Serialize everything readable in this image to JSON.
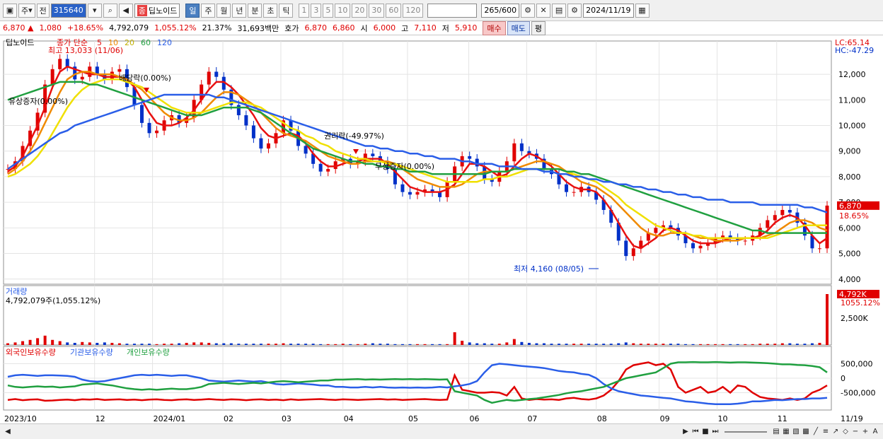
{
  "toolbar": {
    "period_type": "주",
    "previous_label": "전",
    "stock_code": "315640",
    "stock_name": "딥노이드",
    "stock_name_badge": "종",
    "tabs": [
      "일",
      "주",
      "월",
      "년",
      "분",
      "초",
      "틱"
    ],
    "active_tab": "일",
    "periods": [
      "1",
      "3",
      "5",
      "10",
      "20",
      "30",
      "60",
      "120"
    ],
    "count": "265/600",
    "date": "2024/11/19"
  },
  "quote": {
    "price": "6,870",
    "change": "1,080",
    "change_pct": "+18.65%",
    "volume": "4,792,079",
    "volume_ratio": "1,055.12%",
    "turnover": "21.37%",
    "amount": "31,693백만",
    "ask_label": "호가",
    "ask1": "6,870",
    "ask2": "6,860",
    "open_label": "시",
    "open": "6,000",
    "high_label": "고",
    "high": "7,110",
    "low_label": "저",
    "low": "5,910",
    "buy": "매수",
    "sell": "매도",
    "eval": "평"
  },
  "price_panel": {
    "name": "딥노이드",
    "legend_prefix": "종가 단순",
    "ma": [
      {
        "label": "5",
        "color": "#e81010"
      },
      {
        "label": "10",
        "color": "#f08a00"
      },
      {
        "label": "20",
        "color": "#f0e000"
      },
      {
        "label": "60",
        "color": "#20a040"
      },
      {
        "label": "120",
        "color": "#2a5ee8"
      }
    ],
    "lc": "LC:65.14",
    "hc": "HC:-47.29",
    "yticks": [
      "12,000",
      "11,000",
      "10,000",
      "9,000",
      "8,000",
      "7,000",
      "6,000",
      "5,000",
      "4,000"
    ],
    "last_price": "6,870",
    "last_pct": "18.65%",
    "annotations": {
      "high": "최고 13,033 (11/06)",
      "low": "최저 4,160 (08/05)",
      "dividend": "배당락(0.00%)",
      "rights": "권리락(-49.97%)",
      "bonus1": "무상증자(0.00%)",
      "bonus2": "유상증자(0.00%)"
    }
  },
  "volume_panel": {
    "title": "거래량",
    "value": "4,792,079주(1,055.12%)",
    "ytick": "2,500K",
    "last": "4,792K",
    "last_pct": "1055.12%"
  },
  "holding_panel": {
    "series": [
      {
        "name": "외국인보유수량",
        "color": "#e00000"
      },
      {
        "name": "기관보유수량",
        "color": "#2a5ee8"
      },
      {
        "name": "개인보유수량",
        "color": "#20a040"
      }
    ],
    "yticks": [
      "500,000",
      "0",
      "-500,000"
    ]
  },
  "xaxis": [
    "2023/10",
    "12",
    "2024/01",
    "02",
    "03",
    "04",
    "05",
    "06",
    "07",
    "08",
    "09",
    "10",
    "11",
    "11/19"
  ],
  "chart_data": {
    "type": "line",
    "title": "딥노이드",
    "x_labels": [
      "2023/10",
      "12",
      "2024/01",
      "02",
      "03",
      "04",
      "05",
      "06",
      "07",
      "08",
      "09",
      "10",
      "11",
      "11/19"
    ],
    "ylim": [
      3800,
      13300
    ],
    "close": [
      8300,
      8600,
      9200,
      9800,
      10500,
      11600,
      12200,
      12600,
      12300,
      11800,
      11900,
      12300,
      12000,
      11800,
      12100,
      12200,
      11500,
      10800,
      10100,
      9700,
      9800,
      10200,
      10400,
      10100,
      10300,
      11000,
      11600,
      12100,
      11900,
      11400,
      10800,
      10400,
      10000,
      9500,
      9100,
      9300,
      9700,
      10200,
      9800,
      9200,
      8900,
      8500,
      8200,
      8300,
      8600,
      8700,
      8500,
      8600,
      8900,
      8800,
      8600,
      8300,
      7700,
      7400,
      7300,
      7400,
      7500,
      7400,
      7200,
      7800,
      8400,
      8800,
      8700,
      8400,
      7900,
      7800,
      8200,
      8600,
      9300,
      9000,
      8900,
      8700,
      8300,
      8100,
      7700,
      7400,
      7400,
      7600,
      7400,
      7100,
      6700,
      6200,
      5500,
      4900,
      5200,
      5500,
      5800,
      6000,
      6100,
      6000,
      5700,
      5400,
      5200,
      5300,
      5400,
      5600,
      5700,
      5600,
      5500,
      5500,
      5700,
      6000,
      6300,
      6500,
      6700,
      6600,
      6200,
      5700,
      5200,
      5200,
      6870
    ],
    "series": [
      {
        "name": "5",
        "values": [
          8200,
          8400,
          8800,
          9400,
          10000,
          10700,
          11500,
          12100,
          12300,
          12200,
          12100,
          12000,
          12000,
          11900,
          11900,
          11900,
          11800,
          11500,
          11000,
          10500,
          10100,
          10000,
          10000,
          10100,
          10300,
          10600,
          11000,
          11400,
          11700,
          11700,
          11500,
          11200,
          10800,
          10400,
          9900,
          9600,
          9500,
          9600,
          9700,
          9600,
          9300,
          8900,
          8600,
          8400,
          8400,
          8500,
          8600,
          8600,
          8700,
          8700,
          8700,
          8500,
          8200,
          7900,
          7600,
          7500,
          7400,
          7400,
          7400,
          7500,
          7700,
          8100,
          8500,
          8500,
          8400,
          8200,
          8000,
          8100,
          8400,
          8700,
          8900,
          8800,
          8600,
          8400,
          8100,
          7800,
          7600,
          7500,
          7500,
          7400,
          7100,
          6700,
          6200,
          5700,
          5300,
          5200,
          5400,
          5600,
          5900,
          6000,
          5900,
          5700,
          5500,
          5400,
          5400,
          5400,
          5500,
          5600,
          5600,
          5600,
          5600,
          5700,
          5900,
          6200,
          6400,
          6500,
          6400,
          6100,
          5700,
          5400,
          5600
        ]
      },
      {
        "name": "10",
        "values": [
          8100,
          8300,
          8600,
          9000,
          9500,
          10100,
          10700,
          11300,
          11800,
          12000,
          12100,
          12100,
          12000,
          12000,
          12000,
          11900,
          11800,
          11600,
          11400,
          11100,
          10800,
          10500,
          10300,
          10200,
          10200,
          10300,
          10500,
          10800,
          11100,
          11300,
          11300,
          11200,
          11000,
          10800,
          10500,
          10200,
          9900,
          9700,
          9600,
          9500,
          9400,
          9200,
          9000,
          8800,
          8700,
          8600,
          8500,
          8500,
          8600,
          8600,
          8600,
          8600,
          8500,
          8300,
          8100,
          7900,
          7800,
          7700,
          7600,
          7600,
          7600,
          7700,
          7900,
          8100,
          8200,
          8200,
          8200,
          8200,
          8300,
          8400,
          8500,
          8600,
          8600,
          8500,
          8400,
          8200,
          8000,
          7800,
          7700,
          7600,
          7400,
          7200,
          6900,
          6600,
          6300,
          6000,
          5800,
          5700,
          5700,
          5800,
          5800,
          5800,
          5700,
          5600,
          5600,
          5500,
          5500,
          5500,
          5500,
          5600,
          5600,
          5600,
          5700,
          5800,
          6000,
          6200,
          6300,
          6300,
          6200,
          6000,
          5900
        ]
      },
      {
        "name": "20",
        "values": [
          8000,
          8100,
          8300,
          8500,
          8800,
          9200,
          9700,
          10200,
          10700,
          11100,
          11400,
          11600,
          11700,
          11800,
          11800,
          11800,
          11700,
          11600,
          11500,
          11300,
          11100,
          10900,
          10700,
          10600,
          10500,
          10500,
          10500,
          10600,
          10700,
          10800,
          10900,
          10900,
          10900,
          10800,
          10700,
          10500,
          10300,
          10100,
          9900,
          9800,
          9600,
          9500,
          9300,
          9200,
          9000,
          8900,
          8800,
          8700,
          8700,
          8600,
          8600,
          8500,
          8500,
          8400,
          8300,
          8200,
          8100,
          8000,
          7900,
          7800,
          7800,
          7800,
          7800,
          7800,
          7900,
          7900,
          8000,
          8000,
          8100,
          8200,
          8300,
          8300,
          8300,
          8300,
          8300,
          8200,
          8100,
          8000,
          7900,
          7800,
          7600,
          7400,
          7200,
          6900,
          6700,
          6500,
          6300,
          6100,
          6000,
          5900,
          5800,
          5800,
          5700,
          5700,
          5600,
          5600,
          5600,
          5600,
          5600,
          5600,
          5600,
          5600,
          5600,
          5700,
          5800,
          5900,
          6000,
          6100,
          6100,
          6100,
          6100
        ]
      },
      {
        "name": "60",
        "values": [
          11000,
          11100,
          11200,
          11300,
          11400,
          11500,
          11600,
          11700,
          11700,
          11700,
          11700,
          11600,
          11600,
          11500,
          11400,
          11300,
          11200,
          11100,
          11000,
          10900,
          10800,
          10700,
          10600,
          10500,
          10400,
          10400,
          10400,
          10500,
          10600,
          10700,
          10700,
          10700,
          10700,
          10600,
          10500,
          10300,
          10100,
          9900,
          9700,
          9500,
          9300,
          9100,
          9000,
          8900,
          8800,
          8700,
          8600,
          8600,
          8500,
          8500,
          8400,
          8400,
          8300,
          8300,
          8200,
          8200,
          8200,
          8100,
          8100,
          8100,
          8100,
          8100,
          8100,
          8100,
          8100,
          8200,
          8200,
          8200,
          8300,
          8300,
          8300,
          8300,
          8300,
          8300,
          8300,
          8200,
          8200,
          8100,
          8100,
          8000,
          7900,
          7800,
          7700,
          7600,
          7500,
          7400,
          7300,
          7200,
          7100,
          7000,
          6900,
          6800,
          6700,
          6600,
          6500,
          6400,
          6300,
          6200,
          6100,
          6000,
          5900,
          5900,
          5800,
          5800,
          5800,
          5800,
          5800,
          5800,
          5800,
          5800,
          5800
        ]
      },
      {
        "name": "120",
        "values": [
          8300,
          8500,
          8700,
          8900,
          9100,
          9300,
          9500,
          9700,
          9800,
          10000,
          10100,
          10200,
          10300,
          10400,
          10500,
          10600,
          10700,
          10800,
          10900,
          11000,
          11100,
          11200,
          11200,
          11200,
          11200,
          11200,
          11200,
          11200,
          11100,
          11100,
          11000,
          10900,
          10800,
          10700,
          10600,
          10500,
          10400,
          10300,
          10200,
          10100,
          10000,
          9900,
          9800,
          9700,
          9600,
          9500,
          9400,
          9300,
          9200,
          9200,
          9100,
          9100,
          9000,
          9000,
          8900,
          8900,
          8800,
          8800,
          8700,
          8700,
          8700,
          8600,
          8600,
          8500,
          8500,
          8500,
          8400,
          8400,
          8400,
          8300,
          8300,
          8300,
          8200,
          8200,
          8100,
          8100,
          8000,
          8000,
          7900,
          7900,
          7800,
          7800,
          7700,
          7700,
          7600,
          7600,
          7500,
          7500,
          7400,
          7400,
          7300,
          7300,
          7200,
          7200,
          7100,
          7100,
          7100,
          7000,
          7000,
          7000,
          7000,
          6900,
          6900,
          6900,
          6900,
          6900,
          6900,
          6800,
          6800,
          6700,
          6600
        ]
      }
    ],
    "volume": [
      4,
      6,
      9,
      12,
      16,
      22,
      12,
      9,
      6,
      5,
      7,
      6,
      5,
      6,
      5,
      4,
      3,
      3,
      3,
      3,
      2,
      3,
      3,
      4,
      5,
      6,
      6,
      5,
      4,
      4,
      4,
      3,
      3,
      3,
      3,
      3,
      3,
      4,
      3,
      3,
      3,
      3,
      2,
      2,
      2,
      3,
      2,
      2,
      3,
      4,
      3,
      3,
      2,
      2,
      2,
      2,
      2,
      2,
      2,
      2,
      30,
      10,
      6,
      4,
      4,
      3,
      3,
      6,
      14,
      7,
      5,
      4,
      4,
      3,
      3,
      3,
      3,
      3,
      3,
      3,
      3,
      3,
      4,
      6,
      4,
      3,
      3,
      3,
      3,
      3,
      3,
      2,
      2,
      2,
      2,
      2,
      2,
      2,
      2,
      2,
      2,
      3,
      3,
      3,
      4,
      4,
      3,
      3,
      4,
      5,
      120
    ],
    "holdings": {
      "foreign": [
        -0.75,
        -0.72,
        -0.76,
        -0.74,
        -0.73,
        -0.78,
        -0.77,
        -0.75,
        -0.74,
        -0.76,
        -0.73,
        -0.74,
        -0.72,
        -0.75,
        -0.74,
        -0.73,
        -0.75,
        -0.74,
        -0.76,
        -0.74,
        -0.73,
        -0.75,
        -0.76,
        -0.74,
        -0.73,
        -0.75,
        -0.74,
        -0.72,
        -0.74,
        -0.75,
        -0.73,
        -0.74,
        -0.76,
        -0.74,
        -0.73,
        -0.75,
        -0.74,
        -0.76,
        -0.73,
        -0.75,
        -0.74,
        -0.73,
        -0.72,
        -0.74,
        -0.75,
        -0.73,
        -0.74,
        -0.75,
        -0.74,
        -0.73,
        -0.72,
        -0.74,
        -0.73,
        -0.75,
        -0.74,
        -0.73,
        -0.72,
        -0.74,
        -0.75,
        -0.74,
        0.1,
        -0.4,
        -0.45,
        -0.5,
        -0.5,
        -0.48,
        -0.5,
        -0.6,
        -0.3,
        -0.7,
        -0.75,
        -0.72,
        -0.74,
        -0.73,
        -0.75,
        -0.7,
        -0.68,
        -0.72,
        -0.74,
        -0.7,
        -0.6,
        -0.4,
        -0.1,
        0.3,
        0.45,
        0.5,
        0.55,
        0.45,
        0.5,
        0.3,
        -0.3,
        -0.5,
        -0.4,
        -0.3,
        -0.5,
        -0.45,
        -0.3,
        -0.5,
        -0.25,
        -0.3,
        -0.5,
        -0.65,
        -0.7,
        -0.72,
        -0.75,
        -0.7,
        -0.75,
        -0.7,
        -0.5,
        -0.4,
        -0.25
      ],
      "institution": [
        0.05,
        0.1,
        0.12,
        0.1,
        0.08,
        0.1,
        0.1,
        0.09,
        0.08,
        0.05,
        -0.05,
        -0.1,
        -0.12,
        -0.1,
        -0.05,
        0.0,
        0.05,
        0.1,
        0.12,
        0.1,
        0.12,
        0.1,
        0.08,
        0.1,
        0.1,
        0.05,
        0.0,
        -0.08,
        -0.1,
        -0.12,
        -0.1,
        -0.08,
        -0.1,
        -0.12,
        -0.1,
        -0.15,
        -0.2,
        -0.22,
        -0.2,
        -0.18,
        -0.2,
        -0.22,
        -0.25,
        -0.25,
        -0.3,
        -0.3,
        -0.32,
        -0.32,
        -0.3,
        -0.32,
        -0.3,
        -0.32,
        -0.33,
        -0.32,
        -0.33,
        -0.32,
        -0.33,
        -0.32,
        -0.3,
        -0.32,
        -0.28,
        -0.25,
        -0.2,
        -0.1,
        0.2,
        0.45,
        0.5,
        0.48,
        0.45,
        0.42,
        0.4,
        0.38,
        0.35,
        0.3,
        0.25,
        0.22,
        0.2,
        0.15,
        0.12,
        0.0,
        -0.2,
        -0.35,
        -0.45,
        -0.5,
        -0.55,
        -0.6,
        -0.62,
        -0.65,
        -0.68,
        -0.7,
        -0.75,
        -0.8,
        -0.82,
        -0.85,
        -0.88,
        -0.9,
        -0.9,
        -0.9,
        -0.88,
        -0.85,
        -0.8,
        -0.8,
        -0.78,
        -0.75,
        -0.76,
        -0.74,
        -0.72,
        -0.72,
        -0.7,
        -0.7,
        -0.68
      ],
      "individual": [
        -0.25,
        -0.3,
        -0.32,
        -0.3,
        -0.28,
        -0.3,
        -0.29,
        -0.32,
        -0.3,
        -0.28,
        -0.22,
        -0.2,
        -0.18,
        -0.22,
        -0.25,
        -0.3,
        -0.35,
        -0.38,
        -0.4,
        -0.38,
        -0.4,
        -0.38,
        -0.36,
        -0.38,
        -0.38,
        -0.35,
        -0.3,
        -0.2,
        -0.18,
        -0.16,
        -0.18,
        -0.2,
        -0.18,
        -0.16,
        -0.18,
        -0.15,
        -0.12,
        -0.1,
        -0.12,
        -0.14,
        -0.12,
        -0.1,
        -0.08,
        -0.08,
        -0.05,
        -0.05,
        -0.04,
        -0.03,
        -0.05,
        -0.04,
        -0.05,
        -0.04,
        -0.03,
        -0.04,
        -0.03,
        -0.04,
        -0.03,
        -0.04,
        -0.05,
        -0.04,
        -0.45,
        -0.5,
        -0.55,
        -0.6,
        -0.75,
        -0.85,
        -0.8,
        -0.75,
        -0.78,
        -0.75,
        -0.72,
        -0.7,
        -0.66,
        -0.62,
        -0.58,
        -0.52,
        -0.48,
        -0.45,
        -0.4,
        -0.35,
        -0.3,
        -0.2,
        -0.1,
        0.0,
        0.05,
        0.1,
        0.15,
        0.2,
        0.35,
        0.5,
        0.55,
        0.55,
        0.56,
        0.55,
        0.55,
        0.56,
        0.55,
        0.54,
        0.55,
        0.55,
        0.54,
        0.53,
        0.52,
        0.5,
        0.48,
        0.48,
        0.46,
        0.45,
        0.42,
        0.38,
        0.2
      ]
    }
  }
}
